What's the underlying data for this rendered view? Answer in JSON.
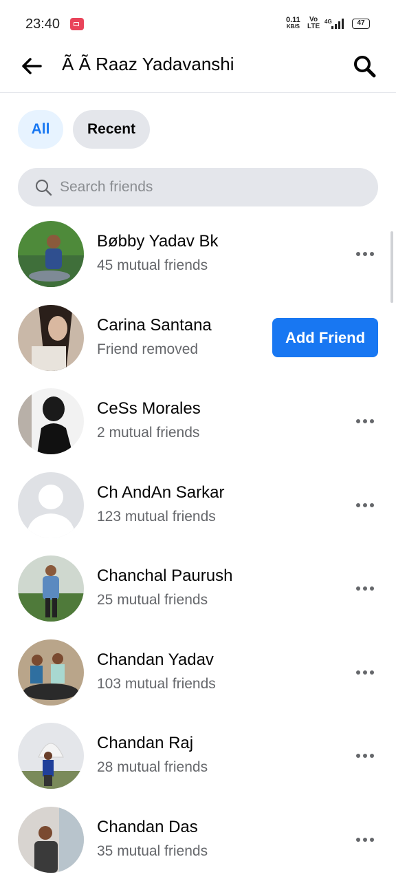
{
  "status_bar": {
    "time": "23:40",
    "net_speed": "0.11",
    "net_unit": "KB/S",
    "volte_top": "Vo",
    "volte_bottom": "LTE",
    "network": "4G",
    "battery": "47"
  },
  "header": {
    "title": "Ã Ã Raaz Yadavanshi"
  },
  "filters": {
    "all": "All",
    "recent": "Recent"
  },
  "search": {
    "placeholder": "Search friends"
  },
  "friends": [
    {
      "name": "Bøbby Yadav Bk",
      "subtitle": "45 mutual friends"
    },
    {
      "name": "Carina Santana",
      "subtitle": "Friend removed",
      "action": "Add Friend"
    },
    {
      "name": "CeSs Morales",
      "subtitle": "2 mutual friends"
    },
    {
      "name": "Ch AndAn Sarkar",
      "subtitle": "123 mutual friends"
    },
    {
      "name": "Chanchal Paurush",
      "subtitle": "25 mutual friends"
    },
    {
      "name": "Chandan Yadav",
      "subtitle": "103 mutual friends"
    },
    {
      "name": "Chandan Raj",
      "subtitle": "28 mutual friends"
    },
    {
      "name": "Chandan Das",
      "subtitle": "35 mutual friends"
    }
  ],
  "colors": {
    "accent": "#1877f2",
    "chip_active_bg": "#e7f3ff",
    "chip_bg": "#e4e6eb",
    "secondary_text": "#65676b"
  }
}
